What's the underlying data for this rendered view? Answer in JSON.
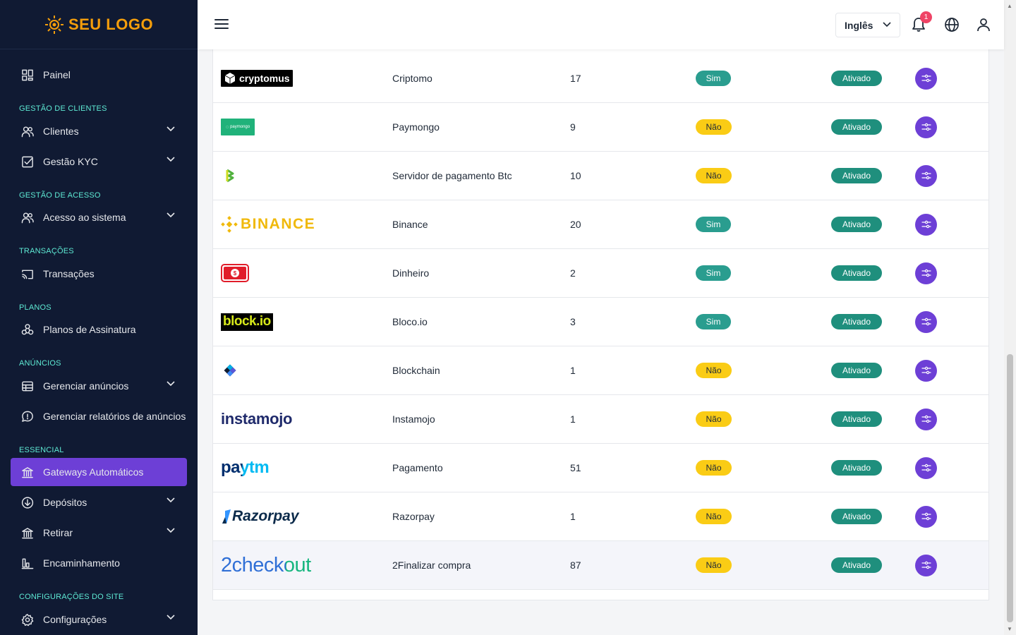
{
  "brand": {
    "logo_text": "SEU LOGO",
    "accent": "#6d3fd6"
  },
  "sidebar": {
    "items": [
      {
        "type": "item",
        "label": "Painel",
        "icon": "dashboard-icon",
        "chevron": false
      },
      {
        "type": "section",
        "label": "GESTÃO DE CLIENTES"
      },
      {
        "type": "item",
        "label": "Clientes",
        "icon": "users-icon",
        "chevron": true
      },
      {
        "type": "item",
        "label": "Gestão KYC",
        "icon": "checkbox-icon",
        "chevron": true
      },
      {
        "type": "section",
        "label": "GESTÃO DE ACESSO"
      },
      {
        "type": "item",
        "label": "Acesso ao sistema",
        "icon": "users-icon",
        "chevron": true
      },
      {
        "type": "section",
        "label": "TRANSAÇÕES"
      },
      {
        "type": "item",
        "label": "Transações",
        "icon": "cast-icon",
        "chevron": false
      },
      {
        "type": "section",
        "label": "PLANOS"
      },
      {
        "type": "item",
        "label": "Planos de Assinatura",
        "icon": "boxes-icon",
        "chevron": false
      },
      {
        "type": "section",
        "label": "ANÚNCIOS"
      },
      {
        "type": "item",
        "label": "Gerenciar anúncios",
        "icon": "table-icon",
        "chevron": true
      },
      {
        "type": "item",
        "label": "Gerenciar relatórios de anúncios",
        "icon": "chat-icon",
        "chevron": false
      },
      {
        "type": "section",
        "label": "ESSENCIAL"
      },
      {
        "type": "item",
        "label": "Gateways Automáticos",
        "icon": "bank-icon",
        "chevron": false,
        "active": true
      },
      {
        "type": "item",
        "label": "Depósitos",
        "icon": "download-circle-icon",
        "chevron": true
      },
      {
        "type": "item",
        "label": "Retirar",
        "icon": "bank-icon",
        "chevron": true
      },
      {
        "type": "item",
        "label": "Encaminhamento",
        "icon": "chart-icon",
        "chevron": false
      },
      {
        "type": "section",
        "label": "CONFIGURAÇÕES DO SITE"
      },
      {
        "type": "item",
        "label": "Configurações",
        "icon": "gear-icon",
        "chevron": true
      }
    ]
  },
  "header": {
    "language": "Inglês",
    "notification_count": "1"
  },
  "table": {
    "rows": [
      {
        "logo": "cryptomus",
        "logo_text": "cryptomus",
        "name": "Criptomo",
        "count": "17",
        "global": "Sim",
        "status": "Ativado"
      },
      {
        "logo": "paymongo",
        "logo_text": "paymongo",
        "name": "Paymongo",
        "count": "9",
        "global": "Não",
        "status": "Ativado"
      },
      {
        "logo": "btcpay",
        "logo_text": "",
        "name": "Servidor de pagamento Btc",
        "count": "10",
        "global": "Não",
        "status": "Ativado"
      },
      {
        "logo": "binance",
        "logo_text": "BINANCE",
        "name": "Binance",
        "count": "20",
        "global": "Sim",
        "status": "Ativado"
      },
      {
        "logo": "cash",
        "logo_text": "",
        "name": "Dinheiro",
        "count": "2",
        "global": "Sim",
        "status": "Ativado"
      },
      {
        "logo": "blockio",
        "logo_text": "block.io",
        "name": "Bloco.io",
        "count": "3",
        "global": "Sim",
        "status": "Ativado"
      },
      {
        "logo": "blockchain",
        "logo_text": "",
        "name": "Blockchain",
        "count": "1",
        "global": "Não",
        "status": "Ativado"
      },
      {
        "logo": "instamojo",
        "logo_text": "instamojo",
        "name": "Instamojo",
        "count": "1",
        "global": "Não",
        "status": "Ativado"
      },
      {
        "logo": "paytm",
        "logo_text": "paytm",
        "name": "Pagamento",
        "count": "51",
        "global": "Não",
        "status": "Ativado"
      },
      {
        "logo": "razorpay",
        "logo_text": "Razorpay",
        "name": "Razorpay",
        "count": "1",
        "global": "Não",
        "status": "Ativado"
      },
      {
        "logo": "2checkout",
        "logo_text": "2checkout",
        "name": "2Finalizar compra",
        "count": "87",
        "global": "Não",
        "status": "Ativado",
        "hover": true
      }
    ]
  }
}
